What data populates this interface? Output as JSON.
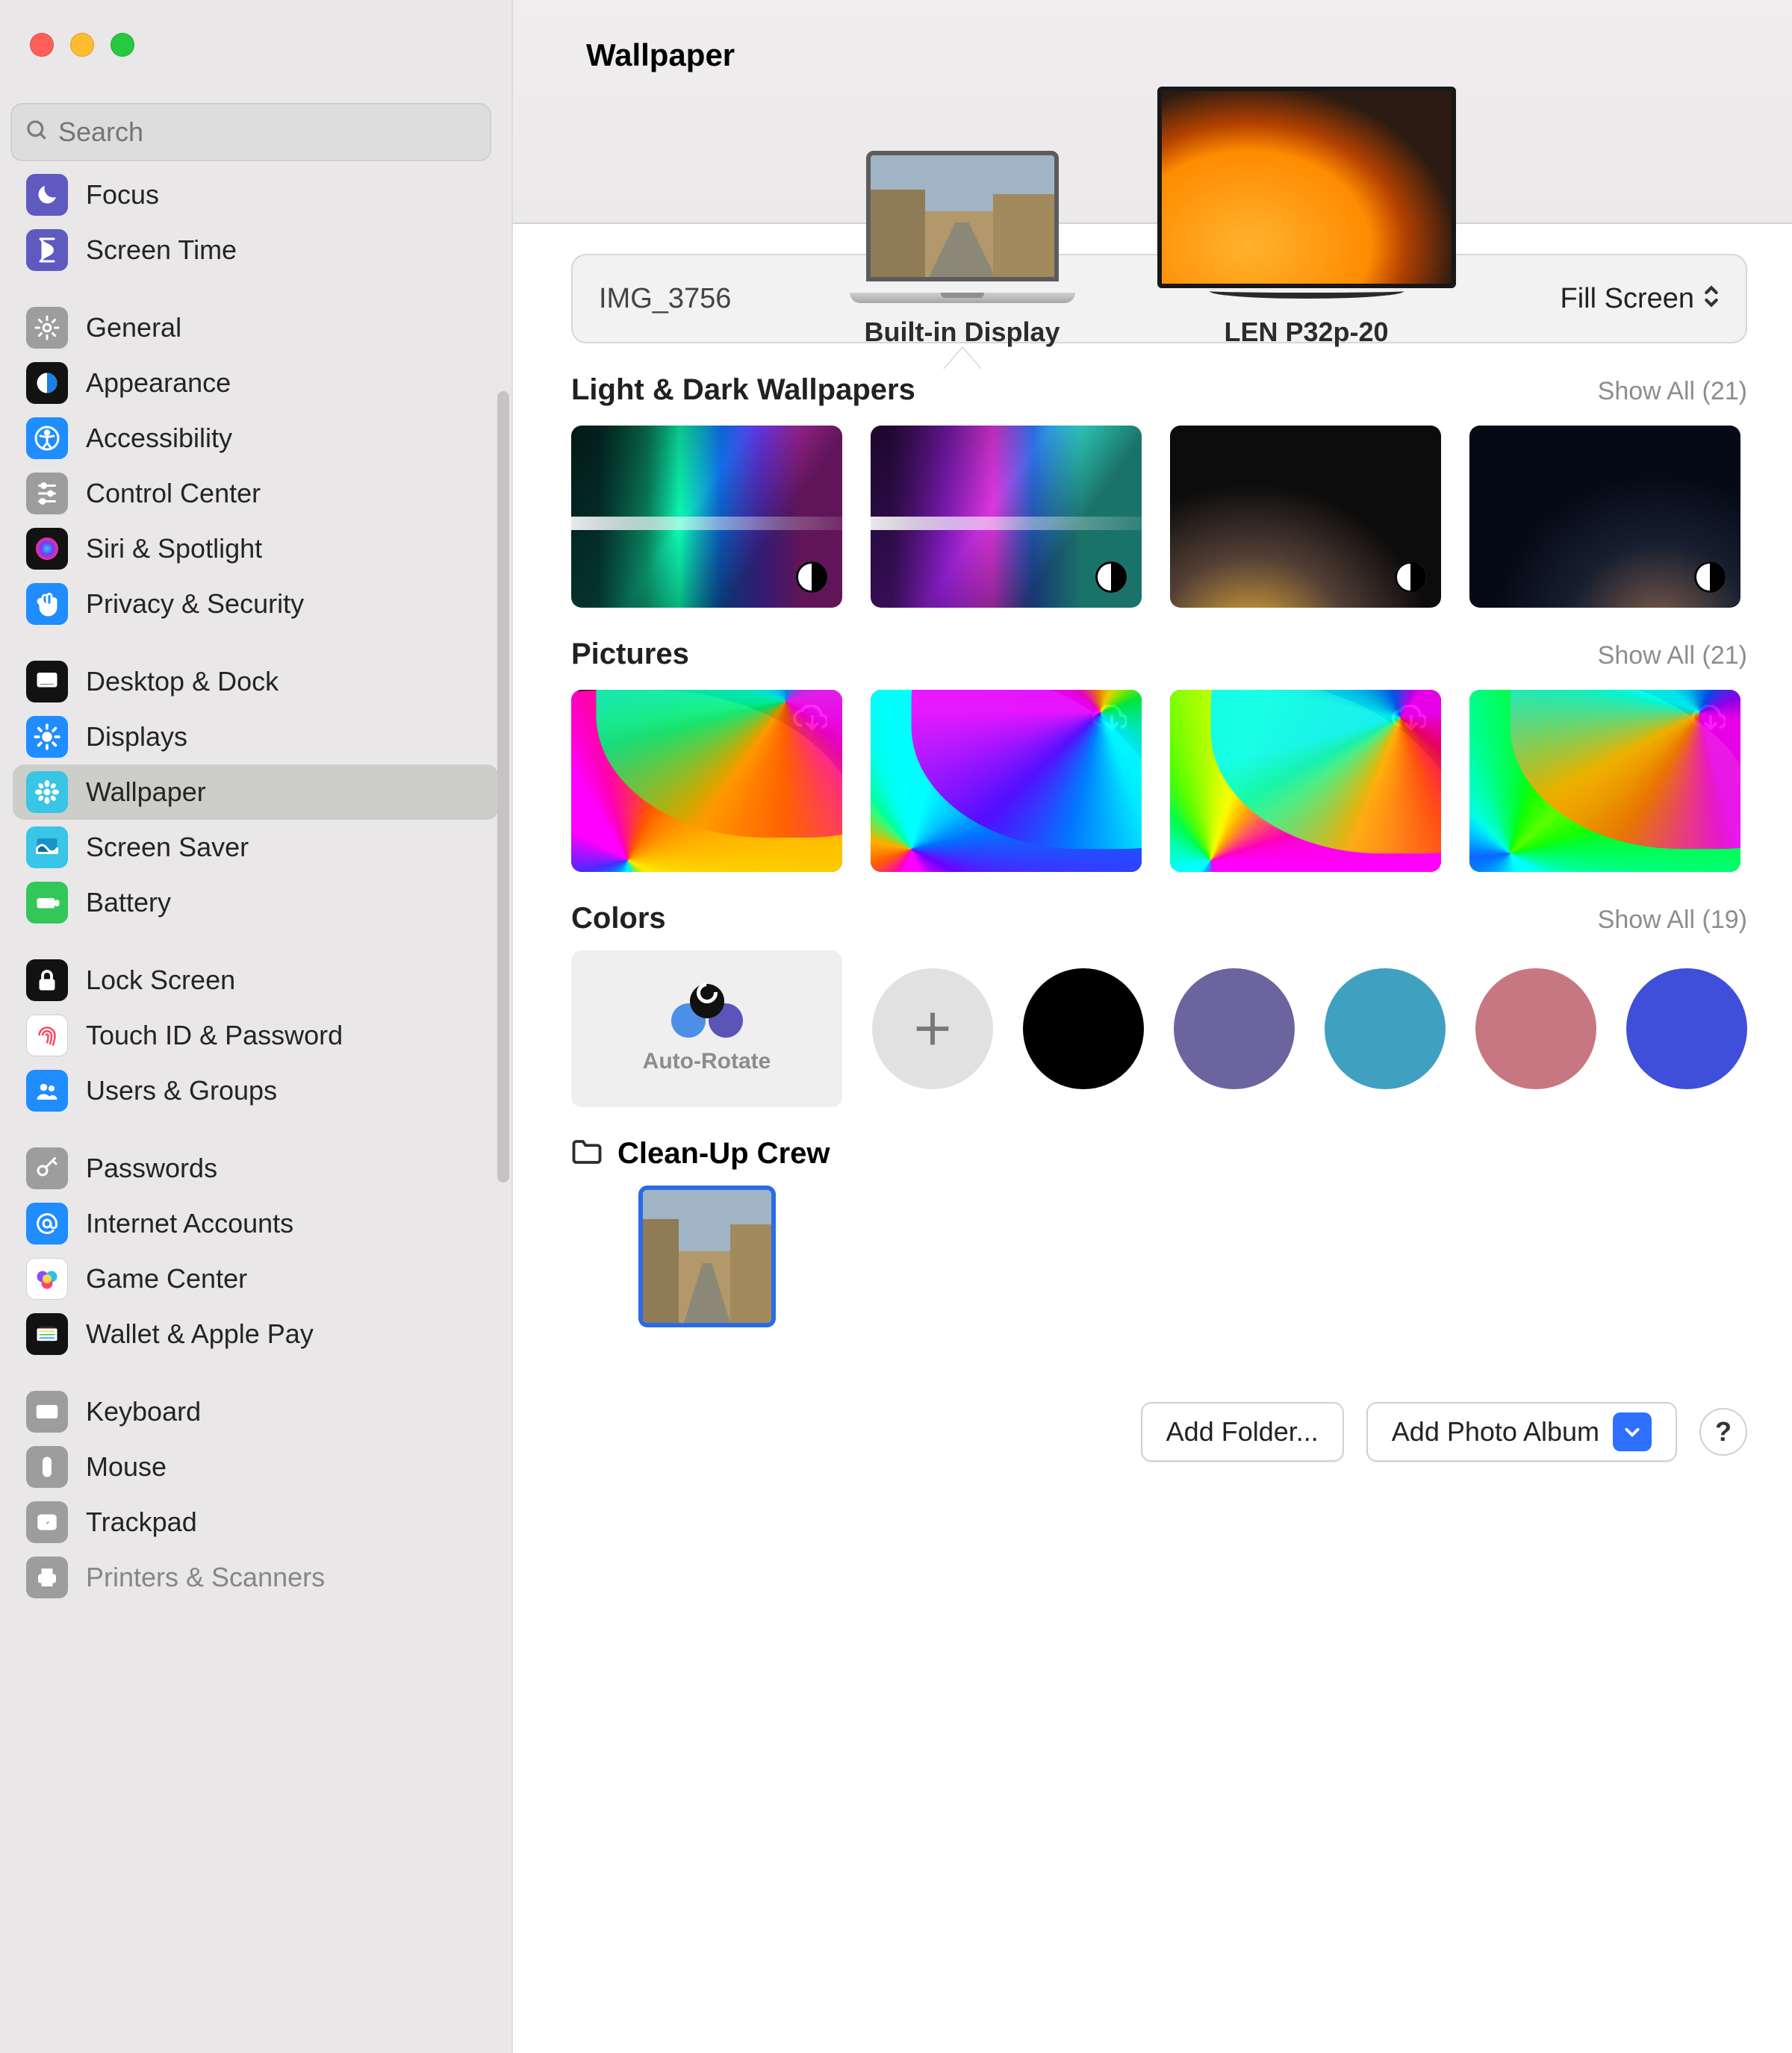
{
  "search": {
    "placeholder": "Search"
  },
  "page_title": "Wallpaper",
  "sidebar": {
    "items": [
      {
        "label": "Focus",
        "icon": "moon",
        "bg": "#5f5ac0"
      },
      {
        "label": "Screen Time",
        "icon": "hourglass",
        "bg": "#5f5ac0"
      },
      {
        "gap": true
      },
      {
        "label": "General",
        "icon": "gear",
        "bg": "#9d9d9d"
      },
      {
        "label": "Appearance",
        "icon": "appearance",
        "bg": "#121212"
      },
      {
        "label": "Accessibility",
        "icon": "accessibility",
        "bg": "#1f8cff"
      },
      {
        "label": "Control Center",
        "icon": "sliders",
        "bg": "#9d9d9d"
      },
      {
        "label": "Siri & Spotlight",
        "icon": "siri",
        "bg": "#121212"
      },
      {
        "label": "Privacy & Security",
        "icon": "hand",
        "bg": "#1f8cff"
      },
      {
        "gap": true
      },
      {
        "label": "Desktop & Dock",
        "icon": "dock",
        "bg": "#121212"
      },
      {
        "label": "Displays",
        "icon": "sun",
        "bg": "#1f8cff"
      },
      {
        "label": "Wallpaper",
        "icon": "flower",
        "bg": "#38c5e6",
        "selected": true
      },
      {
        "label": "Screen Saver",
        "icon": "screensaver",
        "bg": "#38c5e6"
      },
      {
        "label": "Battery",
        "icon": "battery",
        "bg": "#33c759"
      },
      {
        "gap": true
      },
      {
        "label": "Lock Screen",
        "icon": "lock",
        "bg": "#121212"
      },
      {
        "label": "Touch ID & Password",
        "icon": "fingerprint",
        "bg": "#ffffff"
      },
      {
        "label": "Users & Groups",
        "icon": "users",
        "bg": "#1f8cff"
      },
      {
        "gap": true
      },
      {
        "label": "Passwords",
        "icon": "key",
        "bg": "#9d9d9d"
      },
      {
        "label": "Internet Accounts",
        "icon": "at",
        "bg": "#1f8cff"
      },
      {
        "label": "Game Center",
        "icon": "gamecenter",
        "bg": "#ffffff"
      },
      {
        "label": "Wallet & Apple Pay",
        "icon": "wallet",
        "bg": "#121212"
      },
      {
        "gap": true
      },
      {
        "label": "Keyboard",
        "icon": "keyboard",
        "bg": "#9d9d9d"
      },
      {
        "label": "Mouse",
        "icon": "mouse",
        "bg": "#9d9d9d"
      },
      {
        "label": "Trackpad",
        "icon": "trackpad",
        "bg": "#9d9d9d"
      },
      {
        "label": "Printers & Scanners",
        "icon": "printer",
        "bg": "#9d9d9d",
        "dim": true
      }
    ]
  },
  "displays": [
    {
      "name": "Built-in Display",
      "selected": true
    },
    {
      "name": "LEN P32p-20",
      "selected": false
    }
  ],
  "current": {
    "name": "IMG_3756",
    "fill_mode": "Fill Screen"
  },
  "sections": {
    "light_dark": {
      "title": "Light & Dark Wallpapers",
      "show_all_label": "Show All",
      "count": "(21)"
    },
    "pictures": {
      "title": "Pictures",
      "show_all_label": "Show All",
      "count": "(21)"
    },
    "colors": {
      "title": "Colors",
      "show_all_label": "Show All",
      "count": "(19)",
      "auto_rotate_label": "Auto-Rotate",
      "swatches": [
        "#000000",
        "#6c649e",
        "#3fa1bf",
        "#c77782",
        "#3f4fd9"
      ]
    }
  },
  "folder": {
    "name": "Clean-Up Crew"
  },
  "footer": {
    "add_folder": "Add Folder...",
    "add_album": "Add Photo Album",
    "help": "?"
  }
}
